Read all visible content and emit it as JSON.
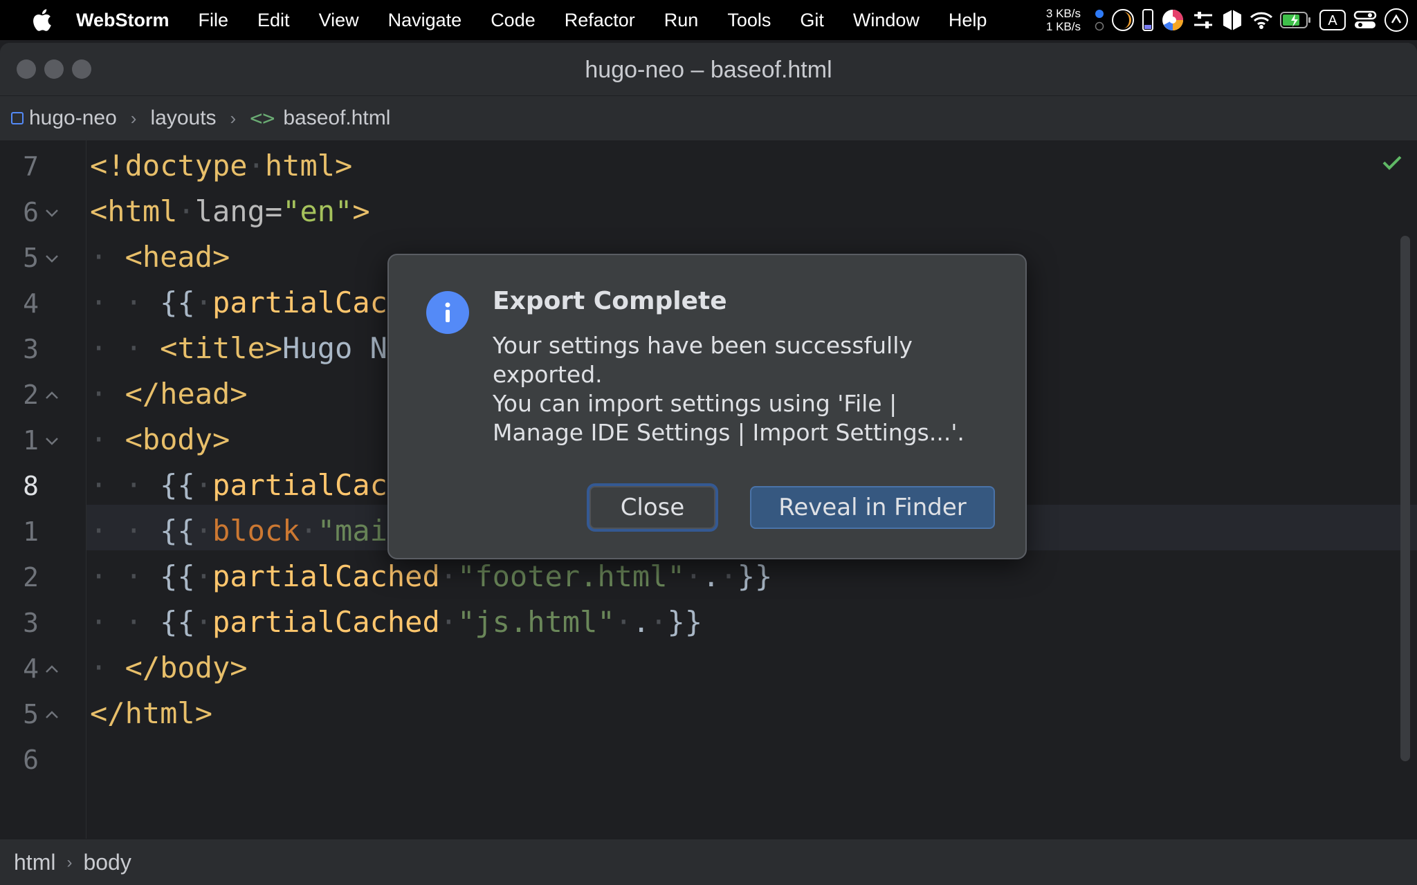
{
  "menubar": {
    "app_name": "WebStorm",
    "items": [
      "File",
      "Edit",
      "View",
      "Navigate",
      "Code",
      "Refactor",
      "Run",
      "Tools",
      "Git",
      "Window",
      "Help"
    ],
    "net_up": "3 KB/s",
    "net_down": "1 KB/s"
  },
  "window": {
    "title": "hugo-neo – baseof.html"
  },
  "breadcrumb": {
    "project": "hugo-neo",
    "folder": "layouts",
    "file": "baseof.html"
  },
  "editor": {
    "line_numbers": [
      "7",
      "6",
      "5",
      "4",
      "3",
      "2",
      "1",
      "8",
      "1",
      "2",
      "3",
      "4",
      "5",
      "6"
    ],
    "current_line": "8"
  },
  "code": {
    "l1_open": "<!doctype",
    "l1_word": "html",
    "l1_close": ">",
    "l2_open": "<html",
    "l2_attr": "lang",
    "l2_eq": "=",
    "l2_val": "\"en\"",
    "l2_close": ">",
    "l3": "<head>",
    "l4_brace": "{{",
    "l4_fn": "partialCac",
    "l5_tag": "<title>",
    "l5_text": "Hugo N",
    "l6": "</head>",
    "l7": "<body>",
    "l8_brace": "{{",
    "l8_fn": "partialCac",
    "l9_brace": "{{",
    "l9_kw": "block",
    "l9_str": "\"mai",
    "l10_brace": "{{",
    "l10_fn": "partialCached",
    "l10_str": "\"footer.html\"",
    "l10_dot": ".",
    "l10_end": "}}",
    "l11_brace": "{{",
    "l11_fn": "partialCached",
    "l11_str": "\"js.html\"",
    "l11_dot": ".",
    "l11_end": "}}",
    "l12": "</body>",
    "l13": "</html>"
  },
  "statusbar": {
    "crumb_1": "html",
    "crumb_2": "body"
  },
  "dialog": {
    "title": "Export Complete",
    "message_1": "Your settings have been successfully exported.",
    "message_2": "You can import settings using 'File | Manage IDE Settings | Import Settings...'.",
    "close_label": "Close",
    "reveal_label": "Reveal in Finder"
  },
  "colors": {
    "accent": "#548af7",
    "primary_button": "#365880",
    "tag": "#e8bf6a",
    "string": "#6a8759",
    "keyword": "#cc7832"
  }
}
